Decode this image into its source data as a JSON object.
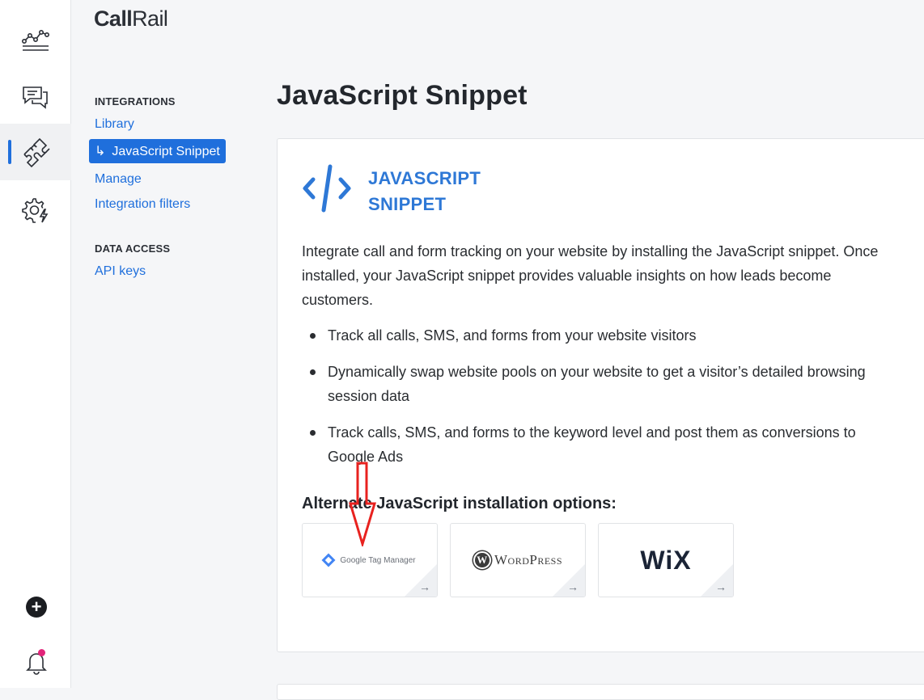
{
  "brand": {
    "call": "Call",
    "rail": "Rail"
  },
  "rail": {
    "items": [
      {
        "name": "analytics"
      },
      {
        "name": "conversations"
      },
      {
        "name": "integrations",
        "active": true
      },
      {
        "name": "settings"
      }
    ]
  },
  "subnav": {
    "groups": [
      {
        "heading": "INTEGRATIONS",
        "links": [
          {
            "label": "Library"
          },
          {
            "label": "JavaScript Snippet",
            "active": true
          },
          {
            "label": "Manage"
          },
          {
            "label": "Integration filters"
          }
        ]
      },
      {
        "heading": "DATA ACCESS",
        "links": [
          {
            "label": "API keys"
          }
        ]
      }
    ],
    "active_arrow": "↳"
  },
  "main": {
    "title": "JavaScript Snippet",
    "hero": {
      "line1": "JAVASCRIPT",
      "line2": "SNIPPET"
    },
    "description": "Integrate call and form tracking on your website by installing the JavaScript snippet. Once installed, your JavaScript snippet provides valuable insights on how leads become customers.",
    "bullets": [
      "Track all calls, SMS, and forms from your website visitors",
      "Dynamically swap website pools on your website to get a visitor’s detailed browsing session data",
      "Track calls, SMS, and forms to the keyword level and post them as conversions to Google Ads"
    ],
    "alt_heading": "Alternate JavaScript installation options:",
    "options": [
      {
        "label": "Google Tag Manager"
      },
      {
        "label": "WordPress"
      },
      {
        "label": "WiX"
      }
    ],
    "option_arrow": "→"
  },
  "colors": {
    "accent": "#1f6fdc",
    "notification": "#e2257a",
    "annotation": "#e8221f"
  }
}
